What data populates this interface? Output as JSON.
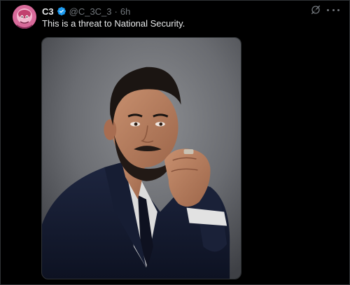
{
  "post": {
    "author": {
      "name": "C3",
      "handle": "@C_3C_3",
      "separator": "·",
      "time": "6h",
      "verified": true,
      "verified_color": "#1d9bf0"
    },
    "text": "This is a threat to National Security.",
    "media": {
      "icon": "photo-portrait"
    }
  },
  "icons": {
    "grok": "grok-icon",
    "more": "more-icon"
  }
}
